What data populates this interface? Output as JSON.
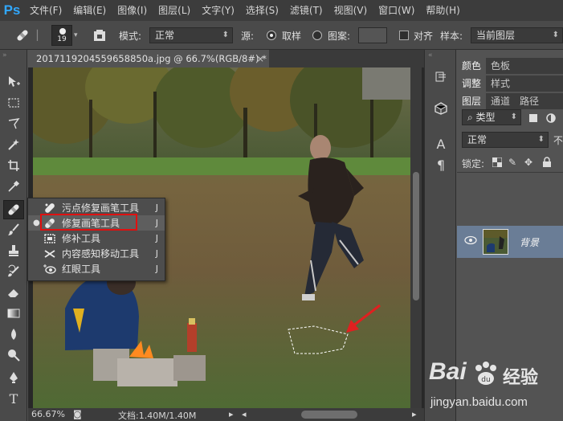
{
  "menubar": {
    "logo": "Ps",
    "items": [
      "文件(F)",
      "编辑(E)",
      "图像(I)",
      "图层(L)",
      "文字(Y)",
      "选择(S)",
      "滤镜(T)",
      "视图(V)",
      "窗口(W)",
      "帮助(H)"
    ]
  },
  "options": {
    "brush_size": "19",
    "mode_label": "模式:",
    "mode_value": "正常",
    "source_label": "源:",
    "sampled_label": "取样",
    "pattern_label": "图案:",
    "aligned_label": "对齐",
    "sample_label": "样本:",
    "sample_value": "当前图层"
  },
  "document": {
    "tab_title": "2017119204559658850a.jpg @ 66.7%(RGB/8#) *",
    "close": "×"
  },
  "statusbar": {
    "zoom": "66.67%",
    "doc_info": "文档:1.40M/1.40M"
  },
  "flyout": {
    "items": [
      {
        "label": "污点修复画笔工具",
        "key": "J"
      },
      {
        "label": "修复画笔工具",
        "key": "J"
      },
      {
        "label": "修补工具",
        "key": "J"
      },
      {
        "label": "内容感知移动工具",
        "key": "J"
      },
      {
        "label": "红眼工具",
        "key": "J"
      }
    ]
  },
  "panels": {
    "row1": [
      "颜色",
      "色板"
    ],
    "row2": [
      "调整",
      "样式"
    ],
    "row3": [
      "图层",
      "通道",
      "路径"
    ],
    "filter_kind": "类型",
    "blend_mode": "正常",
    "opacity_short": "不",
    "lock_label": "锁定:",
    "layer_name": "背景"
  },
  "watermark": {
    "brand": "Bai",
    "brand2": "经验",
    "url": "jingyan.baidu.com"
  },
  "colors": {
    "accent": "#31a8ff",
    "highlight": "#e01010",
    "arrow": "#e02020"
  }
}
